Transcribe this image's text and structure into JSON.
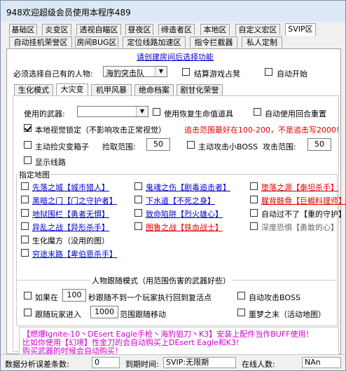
{
  "window": {
    "title": "948欢迎超级会员使用本程序489"
  },
  "tabs_row1": [
    "基础区",
    "炎变区",
    "透视自瞄区",
    "昼夜区",
    "缔造者区",
    "本地区",
    "自定义宏区",
    "SVIP区"
  ],
  "tabs_row1_active": "SVIP区",
  "tabs_row2": [
    "自动挂机荣誉区",
    "房间BUG区",
    "定位线路加速区",
    "指令拦截器",
    "私人定制"
  ],
  "top": {
    "hint": "请创建房间后选择功能",
    "char_label": "必须选择自己有的人物:",
    "char_value": "海豹突击队",
    "settle_label": "结算游戏占凳",
    "auto_start_label": "自动开始"
  },
  "tabs_row3": [
    "生化模式",
    "大灾变",
    "机甲风暴",
    "绝命档案",
    "剧甘化荣誉"
  ],
  "tabs_row3_active": "大灾变",
  "weapon": {
    "label": "使用的武器:",
    "value": "",
    "restore_label": "使用恢复生命值道具",
    "auto_reset_label": "自动使用回合重置"
  },
  "local_view": {
    "label": "本地视觉锁定（不影响攻击正常视觉）",
    "checked": true,
    "range_warn": "追击范围最好在100-200，不是追击写2000!"
  },
  "pickup": {
    "box_label": "主动捡灾变箱子",
    "range_label": "捡取范围:",
    "range_value": "50",
    "boss_label": "主动攻击小BOSS",
    "attack_range_label": "攻击范围:",
    "attack_range_value": "50"
  },
  "show_route_label": "显示线路",
  "maps": {
    "title": "指定地图",
    "col1": [
      "先落之城【城市猎人】",
      "黑暗之门【门之守护者】",
      "地狱围栏【勇者无惧】",
      "异乱之战【异形杀手】",
      "生化魔方（没用的图）",
      "穷途末路【卑伯恩杀手】"
    ],
    "col2": [
      "鬼魂之伤【剧毒追击者】",
      "下水道【不死之身】",
      "致命陷阱【烈火雄心】",
      "图鲁之战【铁血战士】"
    ],
    "col3": [
      "堕落之源【泰坦杀手】",
      "腥背骸骨【巨蝎料理师】",
      "自动过不了【重的守护】",
      "深度恐惧【勇敢的心】"
    ]
  },
  "follow": {
    "title": "人物跟随模式（用范围伤害的武器好些）",
    "if_label": "如果在",
    "seconds": "100",
    "if_tail": "秒跟随不到一个玩家执行回到复活点",
    "auto_boss_label": "自动攻击BOSS",
    "follow_label": "跟随玩家进入",
    "follow_value": "1000",
    "follow_tail": "范围跟随移动",
    "dream_label": "噩梦之末（活动地图）"
  },
  "notice": [
    "【燃爆Ignite-10丶DEsert Eagle手枪丶海豹狙刀丶K3】安装上配件当作BUFF使用！",
    "比如你使用【幻境】性金刀的会自动购买上DEsert Eagle和K3!",
    "购买武器的时候会自动购买！"
  ],
  "status": {
    "error_label": "数据分析误差条数:",
    "error_value": "0",
    "expire_label": "到期时间:",
    "expire_value": "SVIP:无限期",
    "online_label": "在线人数:",
    "online_value": "NAn"
  }
}
